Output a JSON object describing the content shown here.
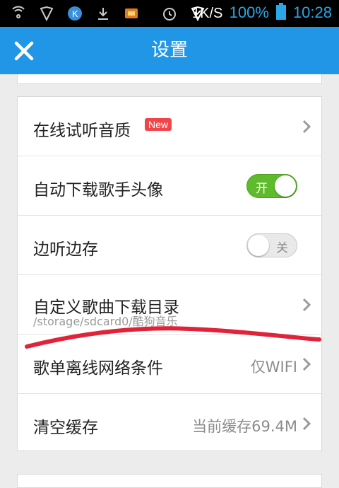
{
  "status_bar": {
    "speed": "1K/S",
    "battery": "100%",
    "time": "10:28",
    "icons": [
      "wifi-signal-icon",
      "shield-icon",
      "k-app-icon",
      "download-icon",
      "game-icon",
      "alarm-icon",
      "shield-check-icon"
    ]
  },
  "header": {
    "title": "设置",
    "close_icon": "close-icon"
  },
  "settings": [
    {
      "label": "在线试听音质",
      "badge": "New",
      "type": "link"
    },
    {
      "label": "自动下载歌手头像",
      "type": "toggle",
      "state": "on",
      "toggle_text": "开"
    },
    {
      "label": "边听边存",
      "type": "toggle",
      "state": "off",
      "toggle_text": "关"
    },
    {
      "label": "自定义歌曲下载目录",
      "sub": "/storage/sdcard0/酷狗音乐",
      "type": "link"
    },
    {
      "label": "歌单离线网络条件",
      "value": "仅WIFI",
      "type": "link"
    },
    {
      "label": "清空缓存",
      "value": "当前缓存69.4M",
      "type": "link"
    }
  ],
  "colors": {
    "accent": "#2196e6",
    "toggle_on": "#5fba2d",
    "badge": "#f0464b",
    "annotation": "#e0233a"
  }
}
